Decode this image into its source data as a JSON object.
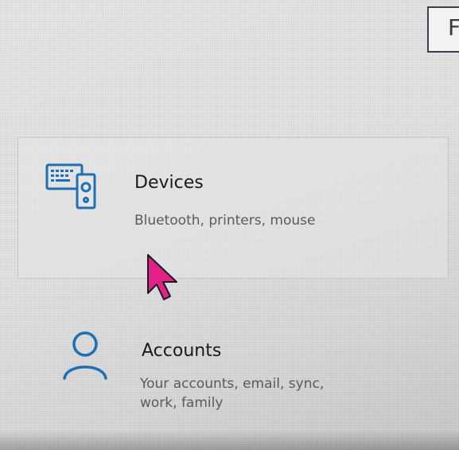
{
  "search": {
    "partial_text": "F"
  },
  "settings": {
    "devices": {
      "title": "Devices",
      "subtitle": "Bluetooth, printers, mouse",
      "icon": "devices-icon",
      "accent": "#1f6fb5"
    },
    "accounts": {
      "title": "Accounts",
      "subtitle_line1": "Your accounts, email, sync,",
      "subtitle_line2": "work, family",
      "icon": "person-icon",
      "accent": "#1f6fb5"
    }
  },
  "cursor": {
    "color": "#e0218a",
    "icon": "mouse-pointer-icon"
  }
}
